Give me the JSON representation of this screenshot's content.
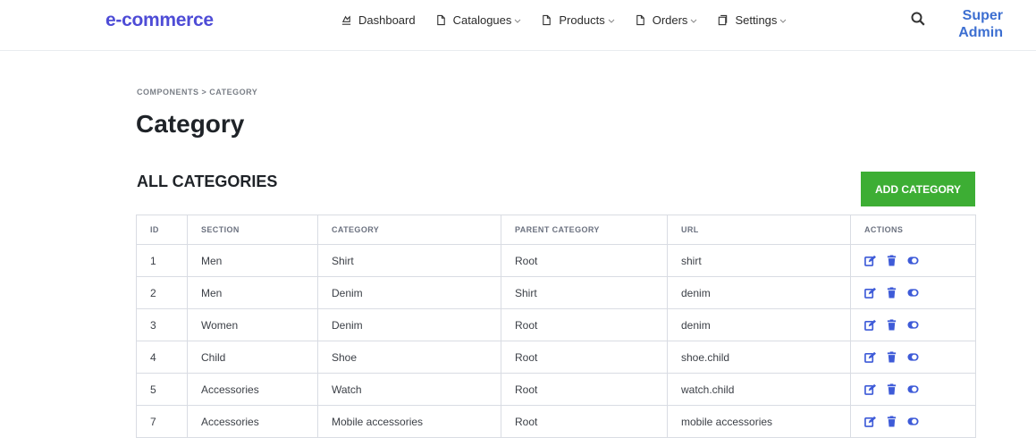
{
  "brand": "e-commerce",
  "nav": [
    {
      "label": "Dashboard",
      "icon": "dashboard-icon",
      "dropdown": false
    },
    {
      "label": "Catalogues",
      "icon": "file-icon",
      "dropdown": true
    },
    {
      "label": "Products",
      "icon": "file-icon",
      "dropdown": true
    },
    {
      "label": "Orders",
      "icon": "file-icon",
      "dropdown": true
    },
    {
      "label": "Settings",
      "icon": "copy-icon",
      "dropdown": true
    }
  ],
  "user": {
    "name": "Super Admin"
  },
  "breadcrumb": "COMPONENTS > CATEGORY",
  "page_title": "Category",
  "section_title": "ALL CATEGORIES",
  "add_button": "ADD CATEGORY",
  "colors": {
    "brand": "#4e4cd6",
    "user": "#3d6fd1",
    "add_button": "#3dae34",
    "action_icons": "#3e5bd8"
  },
  "table": {
    "headers": [
      "ID",
      "SECTION",
      "CATEGORY",
      "PARENT CATEGORY",
      "URL",
      "ACTIONS"
    ],
    "rows": [
      {
        "id": "1",
        "section": "Men",
        "category": "Shirt",
        "parent": "Root",
        "url": "shirt"
      },
      {
        "id": "2",
        "section": "Men",
        "category": "Denim",
        "parent": "Shirt",
        "url": "denim"
      },
      {
        "id": "3",
        "section": "Women",
        "category": "Denim",
        "parent": "Root",
        "url": "denim"
      },
      {
        "id": "4",
        "section": "Child",
        "category": "Shoe",
        "parent": "Root",
        "url": "shoe.child"
      },
      {
        "id": "5",
        "section": "Accessories",
        "category": "Watch",
        "parent": "Root",
        "url": "watch.child"
      },
      {
        "id": "7",
        "section": "Accessories",
        "category": "Mobile accessories",
        "parent": "Root",
        "url": "mobile accessories"
      }
    ],
    "row_actions": [
      "edit-icon",
      "trash-icon",
      "toggle-icon"
    ]
  }
}
